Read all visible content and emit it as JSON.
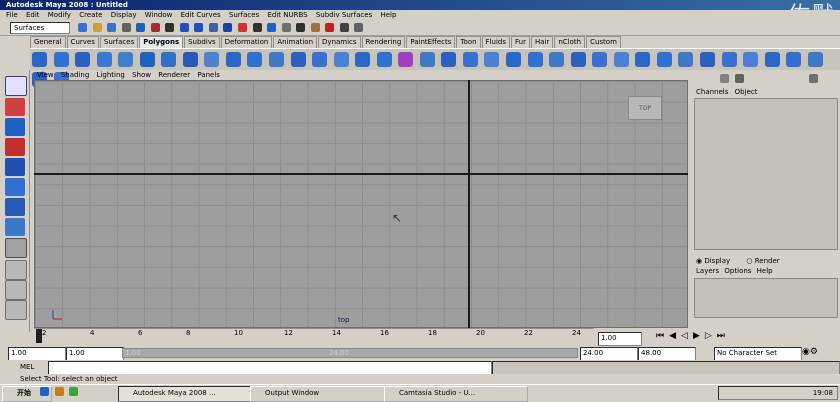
{
  "window": {
    "title": "Autodesk Maya 2008 : Untitled"
  },
  "watermark": "佐默",
  "menubar": [
    "File",
    "Edit",
    "Modify",
    "Create",
    "Display",
    "Window",
    "Edit Curves",
    "Surfaces",
    "Edit NURBS",
    "Subdiv Surfaces",
    "Help"
  ],
  "status_line": {
    "menu_set": "Surfaces"
  },
  "shelf_tabs": [
    "General",
    "Curves",
    "Surfaces",
    "Polygons",
    "Subdivs",
    "Deformation",
    "Animation",
    "Dynamics",
    "Rendering",
    "PaintEffects",
    "Toon",
    "Fluids",
    "Fur",
    "Hair",
    "nCloth",
    "Custom"
  ],
  "active_shelf": "Polygons",
  "viewport": {
    "menu": [
      "View",
      "Shading",
      "Lighting",
      "Show",
      "Renderer",
      "Panels"
    ],
    "camera_label": "top",
    "view_cube_label": "TOP"
  },
  "channel_box": {
    "tabs": [
      "Channels",
      "Object"
    ]
  },
  "layer_editor": {
    "display_label": "Display",
    "render_label": "Render",
    "menu": [
      "Layers",
      "Options",
      "Help"
    ]
  },
  "time_slider": {
    "ticks": [
      "2",
      "4",
      "6",
      "8",
      "10",
      "12",
      "14",
      "16",
      "18",
      "20",
      "22",
      "24"
    ],
    "current_frame": "1.00"
  },
  "range_slider": {
    "start_time": "1.00",
    "playback_start": "1.00",
    "slider_start": "1.00",
    "slider_end": "24.00",
    "end_time": "24.00",
    "playback_end": "48.00",
    "character_set": "No Character Set"
  },
  "command_line": {
    "label": "MEL"
  },
  "help_line": "Select Tool: select an object",
  "taskbar": {
    "start": "开始",
    "items": [
      {
        "label": "Autodesk Maya 2008 ...",
        "active": true
      },
      {
        "label": "Output Window",
        "active": false
      },
      {
        "label": "Camtasia Studio - U...",
        "active": false
      }
    ],
    "clock": "19:08"
  },
  "colors": {
    "viewport_bg": "#9e9e9e",
    "grid": "#8c8c8c",
    "axis": "#1a1a1a",
    "titlebar": "#0a246a"
  }
}
